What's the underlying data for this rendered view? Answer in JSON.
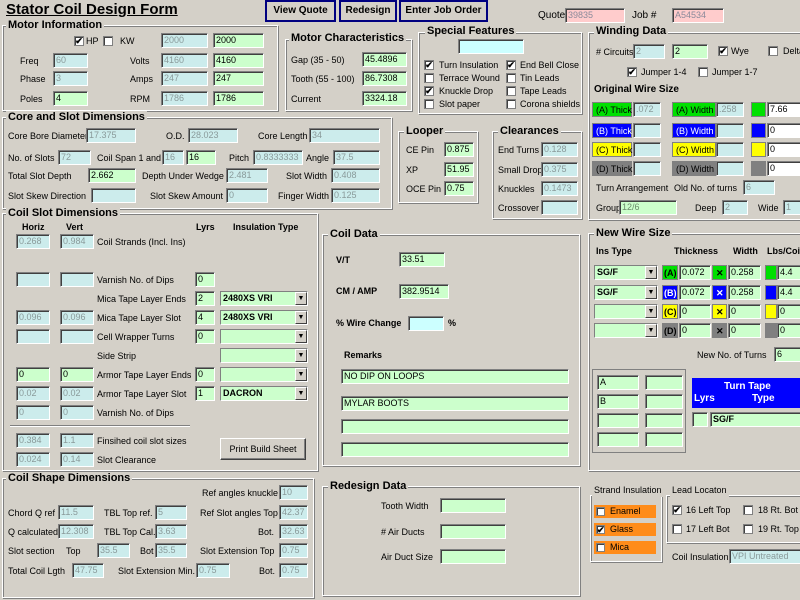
{
  "app": {
    "title": "Stator Coil Design  Form",
    "quote_label": "Quote #",
    "quote_value": "39835",
    "job_label": "Job #",
    "job_value": "A54534"
  },
  "toolbar": {
    "view_quote": "View Quote",
    "redesign": "Redesign",
    "job_order": "Enter Job Order"
  },
  "motor": {
    "title": "Motor Information",
    "hp": "HP",
    "kw": "KW",
    "hp_checked": "✔",
    "kw_value": "2000",
    "hp_value": "2000",
    "freq_l": "Freq",
    "freq": "60",
    "phase_l": "Phase",
    "phase": "3",
    "poles_l": "Poles",
    "poles": "4",
    "volts_l": "Volts",
    "volts_a": "4160",
    "volts_b": "4160",
    "amps_l": "Amps",
    "amps_a": "247",
    "amps_b": "247",
    "rpm_l": "RPM",
    "rpm_a": "1786",
    "rpm_b": "1786"
  },
  "motorchar": {
    "title": "Motor Characteristics",
    "gap_l": "Gap (35 - 50)",
    "gap": "45.4896",
    "tooth_l": "Tooth (55 - 100)",
    "tooth": "86.7308",
    "current_l": "Current",
    "current": "3324.18"
  },
  "special": {
    "title": "Special Features",
    "items": [
      {
        "label": "Turn Insulation",
        "mark": "✔"
      },
      {
        "label": "End Bell Close",
        "mark": "✔"
      },
      {
        "label": "Terrace Wound",
        "mark": ""
      },
      {
        "label": "Tin Leads",
        "mark": ""
      },
      {
        "label": "Knuckle Drop",
        "mark": "✔"
      },
      {
        "label": "Tape Leads",
        "mark": ""
      },
      {
        "label": "Slot paper",
        "mark": ""
      },
      {
        "label": "Corona shields",
        "mark": ""
      }
    ]
  },
  "winding": {
    "title": "Winding Data",
    "circuits_l": "# Circuits",
    "circuits_a": "2",
    "circuits_b": "2",
    "wye": "Wye",
    "wye_mark": "✔",
    "delta": "Delta",
    "jumper14": "Jumper 1-4",
    "jumper14_mark": "✔",
    "jumper17": "Jumper 1-7",
    "orig_title": "Original Wire Size",
    "rows": [
      {
        "a": "(A) Thick",
        "av": ".072",
        "b": "(A) Width",
        "bv": ".258",
        "c": "7.66",
        "color": "#00e000"
      },
      {
        "a": "(B) Thick",
        "av": "",
        "b": "(B) Width",
        "bv": "",
        "c": "0",
        "color": "#0000ff"
      },
      {
        "a": "(C) Thick",
        "av": "",
        "b": "(C) Width",
        "bv": "",
        "c": "0",
        "color": "#ffff00"
      },
      {
        "a": "(D) Thick",
        "av": "",
        "b": "(D) Width",
        "bv": "",
        "c": "0",
        "color": "#808080"
      }
    ],
    "turn_arr_l": "Turn Arrangement",
    "old_turns_l": "Old No. of turns",
    "old_turns": "6",
    "group_l": "Group",
    "group": "12/6",
    "deep_l": "Deep",
    "deep": "2",
    "wide_l": "Wide",
    "wide": "1"
  },
  "core": {
    "title": "Core and Slot Dimensions",
    "bore_l": "Core Bore Diameter",
    "bore": "17.375",
    "od_l": "O.D.",
    "od": "28.023",
    "len_l": "Core Length",
    "len": "34",
    "slots_l": "No. of Slots",
    "slots": "72",
    "span_l": "Coil Span 1 and",
    "span_a": "16",
    "span_b": "16",
    "pitch_l": "Pitch",
    "pitch": "0.8333333",
    "angle_l": "Angle",
    "angle": "37.5",
    "depth_l": "Total Slot Depth",
    "depth": "2.662",
    "wedge_l": "Depth Under Wedge",
    "wedge": "2.481",
    "width_l": "Slot Width",
    "width": "0.408",
    "skdir_l": "Slot Skew Direction",
    "skamt_l": "Slot Skew Amount",
    "skamt": "0",
    "finger_l": "Finger Width",
    "finger": "0.125"
  },
  "looper": {
    "title": "Looper",
    "ce_l": "CE Pin",
    "ce": "0.875",
    "xp_l": "XP",
    "xp": "51.95",
    "oce_l": "OCE Pin",
    "oce": "0.75"
  },
  "clear": {
    "title": "Clearances",
    "end_l": "End Turns",
    "end": "0.128",
    "drop_l": "Small Drop",
    "drop": "0.375",
    "knuck_l": "Knuckles",
    "knuck": "0.1473",
    "cross_l": "Crossover",
    "cross": ""
  },
  "slotdim": {
    "title": "Coil Slot Dimensions",
    "horiz": "Horiz",
    "vert": "Vert",
    "lyrs": "Lyrs",
    "instype": "Insulation Type",
    "strands_h": "0.268",
    "strands_v": "0.984",
    "strands_l": "Coil Strands (Incl. Ins)",
    "varnish_l": "Varnish No. of Dips",
    "varnish": "0",
    "micaend_l": "Mica Tape Layer Ends",
    "micaend": "2",
    "micaend_t": "2480XS VRI",
    "micaslot_h": "0.096",
    "micaslot_v": "0.096",
    "micaslot_l": "Mica Tape Layer Slot",
    "micaslot": "4",
    "micaslot_t": "2480XS VRI",
    "wrap_l": "Cell Wrapper Turns",
    "wrap": "0",
    "side_l": "Side Strip",
    "armend_h": "0",
    "armend_v": "0",
    "armend_l": "Armor Tape Layer Ends",
    "armend": "0",
    "armslot_h": "0.02",
    "armslot_v": "0.02",
    "armslot_l": "Armor Tape Layer Slot",
    "armslot": "1",
    "armslot_t": "DACRON",
    "varn2_h": "0",
    "varn2_v": "0",
    "varn2_l": "Varnish No. of Dips",
    "fin_h": "0.384",
    "fin_v": "1.1",
    "fin_l": "Finsihed coil slot sizes",
    "clr_h": "0.024",
    "clr_v": "0.14",
    "clr_l": "Slot Clearance",
    "print": "Print Build Sheet"
  },
  "coil": {
    "title": "Coil Data",
    "vt_l": "V/T",
    "vt": "33.51",
    "cm_l": "CM / AMP",
    "cm": "382.9514",
    "wire_l": "% Wire Change",
    "pct": "%",
    "remarks_l": "Remarks",
    "remark1": "NO DIP ON LOOPS",
    "remark2": "MYLAR BOOTS"
  },
  "newwire": {
    "title": "New Wire Size",
    "ins_l": "Ins Type",
    "thick_l": "Thickness",
    "width_l": "Width",
    "lbs_l": "Lbs/Coil",
    "rows": [
      {
        "ins": "SG/F",
        "tag": "(A)",
        "t": "0.072",
        "w": "0.258",
        "lbs": "4.4",
        "color": "#00e000"
      },
      {
        "ins": "SG/F",
        "tag": "(B)",
        "t": "0.072",
        "w": "0.258",
        "lbs": "4.4",
        "color": "#0000ff"
      },
      {
        "ins": "",
        "tag": "(C)",
        "t": "0",
        "w": "0",
        "lbs": "0",
        "color": "#ffff00"
      },
      {
        "ins": "",
        "tag": "(D)",
        "t": "0",
        "w": "0",
        "lbs": "0",
        "color": "#808080"
      }
    ],
    "turns_l": "New No. of Turns",
    "turns": "6",
    "a": "A",
    "b": "B",
    "tape_title": "Turn Tape",
    "tape_lyrs": "Lyrs",
    "tape_type": "Type",
    "tape_val": "SG/F"
  },
  "shape": {
    "title": "Coil Shape Dimensions",
    "knuckle_l": "Ref angles knuckle",
    "knuckle": "10",
    "chord_l": "Chord Q ref",
    "chord": "11.5",
    "tbltop_l": "TBL Top ref.",
    "tbltop": "5",
    "refslot_l": "Ref Slot angles Top",
    "refslot": "42.37",
    "qcalc_l": "Q calculated",
    "qcalc": "12.308",
    "tblcal_l": "TBL Top Cal.",
    "tblcal": "3.63",
    "bot_l": "Bot.",
    "bot": "32.63",
    "section_l": "Slot section",
    "top_l": "Top",
    "sec_top": "35.5",
    "bot2_l": "Bot",
    "sec_bot": "35.5",
    "ext_l": "Slot Extension Top",
    "ext": "0.75",
    "total_l": "Total Coil Lgth",
    "total": "47.75",
    "extmin_l": "Slot Extension Min.",
    "extmin": "0.75",
    "bot3_l": "Bot.",
    "bot3": "0.75"
  },
  "redesign": {
    "title": "Redesign Data",
    "tooth_l": "Tooth Width",
    "ducts_l": "# Air Ducts",
    "duct_l": "Air Duct Size"
  },
  "strand": {
    "title": "Strand Insulation",
    "enamel": "Enamel",
    "glass": "Glass",
    "glass_mark": "✔",
    "mica": "Mica"
  },
  "lead": {
    "title": "Lead Locaton",
    "l16": "16 Left Top",
    "l16_mark": "✔",
    "l18": "18 Rt. Bot",
    "l17": "17 Left Bot",
    "l19": "19 Rt. Top",
    "ins_l": "Coil Insulation",
    "ins": "VPI Untreated"
  }
}
